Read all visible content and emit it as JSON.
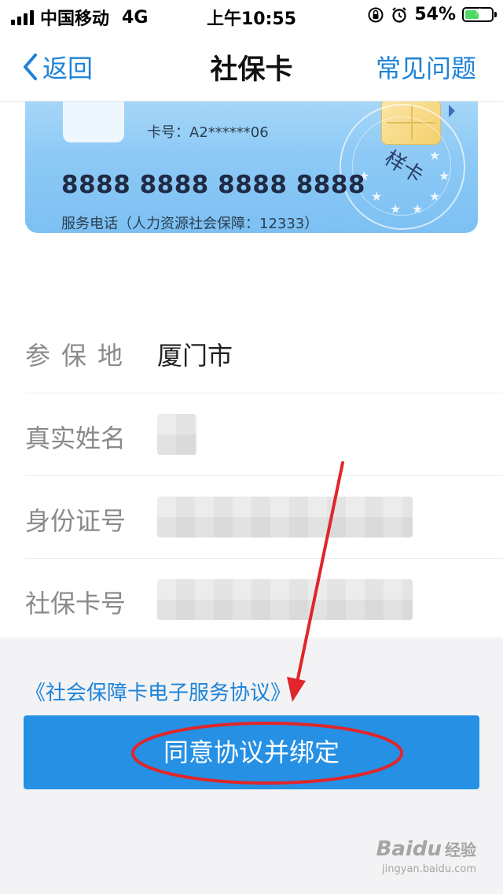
{
  "status_bar": {
    "carrier": "中国移动",
    "network": "4G",
    "time": "上午10:55",
    "battery_percent": "54%",
    "battery_level": 0.54
  },
  "nav": {
    "back_label": "返回",
    "title": "社保卡",
    "help_label": "常见问题"
  },
  "card": {
    "card_number_label": "卡号：A2******06",
    "big_number": "8888 8888 8888 8888",
    "service_phone": "服务电话（人力资源社会保障：12333）",
    "sample_mark": "样卡"
  },
  "form": {
    "insured_place_label": "参保地",
    "insured_place_value": "厦门市",
    "real_name_label": "真实姓名",
    "id_number_label": "身份证号",
    "ss_card_number_label": "社保卡号"
  },
  "footer": {
    "agreement_link": "《社会保障卡电子服务协议》",
    "bind_button": "同意协议并绑定"
  },
  "watermark": {
    "logo": "Baidu",
    "logo_cn": "经验",
    "url": "jingyan.baidu.com"
  },
  "colors": {
    "accent": "#1d83d8",
    "button": "#2590e4",
    "annotation": "#e0262a"
  }
}
